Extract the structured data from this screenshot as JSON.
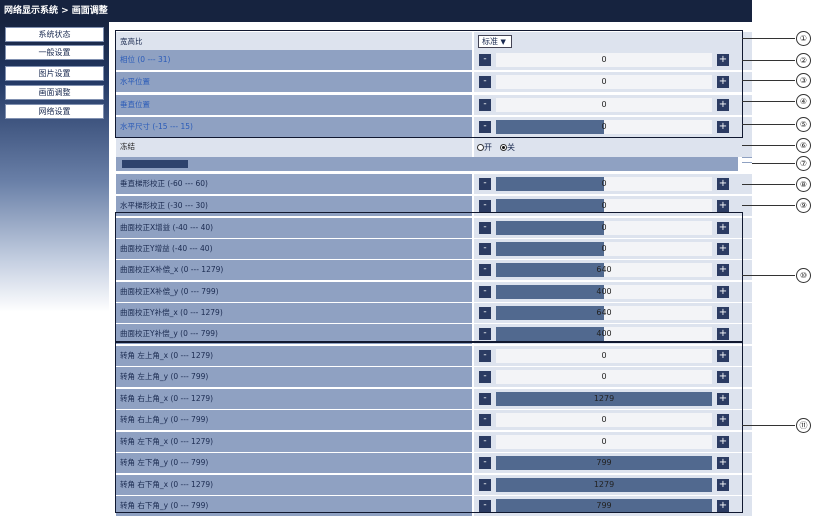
{
  "title": "网络显示系统 > 画面调整",
  "sidebar": {
    "items": [
      {
        "label": "系统状态"
      },
      {
        "label": "一般设置"
      },
      {
        "label": "图片设置"
      },
      {
        "label": "画面调整"
      },
      {
        "label": "网络设置"
      }
    ]
  },
  "aspect": {
    "label": "宽高比",
    "selected": "标准"
  },
  "freeze": {
    "label": "冻结",
    "on_label": "开",
    "off_label": "关",
    "selected": "off"
  },
  "rows": [
    {
      "label": "相位 (0 --- 31)",
      "value": "0",
      "fill": 0,
      "color": "blue"
    },
    {
      "label": "水平位置",
      "value": "0",
      "fill": 0,
      "color": "blue"
    },
    {
      "label": "垂直位置",
      "value": "0",
      "fill": 0,
      "color": "blue"
    },
    {
      "label": "水平尺寸 (-15 --- 15)",
      "value": "0",
      "fill": 0.5,
      "color": "blue"
    },
    {
      "label": "垂直梯形校正 (-60 --- 60)",
      "value": "0",
      "fill": 0.5,
      "color": "dark"
    },
    {
      "label": "水平梯形校正 (-30 --- 30)",
      "value": "0",
      "fill": 0.5,
      "color": "dark"
    },
    {
      "label": "曲面校正X增益 (-40 --- 40)",
      "value": "0",
      "fill": 0.5,
      "color": "dark"
    },
    {
      "label": "曲面校正Y增益 (-40 --- 40)",
      "value": "0",
      "fill": 0.5,
      "color": "dark"
    },
    {
      "label": "曲面校正X补偿_x (0 --- 1279)",
      "value": "640",
      "fill": 0.5,
      "color": "dark"
    },
    {
      "label": "曲面校正X补偿_y (0 --- 799)",
      "value": "400",
      "fill": 0.5,
      "color": "dark"
    },
    {
      "label": "曲面校正Y补偿_x (0 --- 1279)",
      "value": "640",
      "fill": 0.5,
      "color": "dark"
    },
    {
      "label": "曲面校正Y补偿_y (0 --- 799)",
      "value": "400",
      "fill": 0.5,
      "color": "dark"
    },
    {
      "label": "转角 左上角_x (0 --- 1279)",
      "value": "0",
      "fill": 0,
      "color": "dark"
    },
    {
      "label": "转角 左上角_y (0 --- 799)",
      "value": "0",
      "fill": 0,
      "color": "dark"
    },
    {
      "label": "转角 右上角_x (0 --- 1279)",
      "value": "1279",
      "fill": 1,
      "color": "dark"
    },
    {
      "label": "转角 右上角_y (0 --- 799)",
      "value": "0",
      "fill": 0,
      "color": "dark"
    },
    {
      "label": "转角 左下角_x (0 --- 1279)",
      "value": "0",
      "fill": 0,
      "color": "dark"
    },
    {
      "label": "转角 左下角_y (0 --- 799)",
      "value": "799",
      "fill": 1,
      "color": "dark"
    },
    {
      "label": "转角 右下角_x (0 --- 1279)",
      "value": "1279",
      "fill": 1,
      "color": "dark"
    },
    {
      "label": "转角 右下角_y (0 --- 799)",
      "value": "799",
      "fill": 1,
      "color": "dark"
    }
  ],
  "buttons": {
    "minus": "-",
    "plus": "+"
  },
  "callouts": [
    "①",
    "②",
    "③",
    "④",
    "⑤",
    "⑥",
    "⑦",
    "⑧",
    "⑨",
    "⑩",
    "⑪"
  ]
}
